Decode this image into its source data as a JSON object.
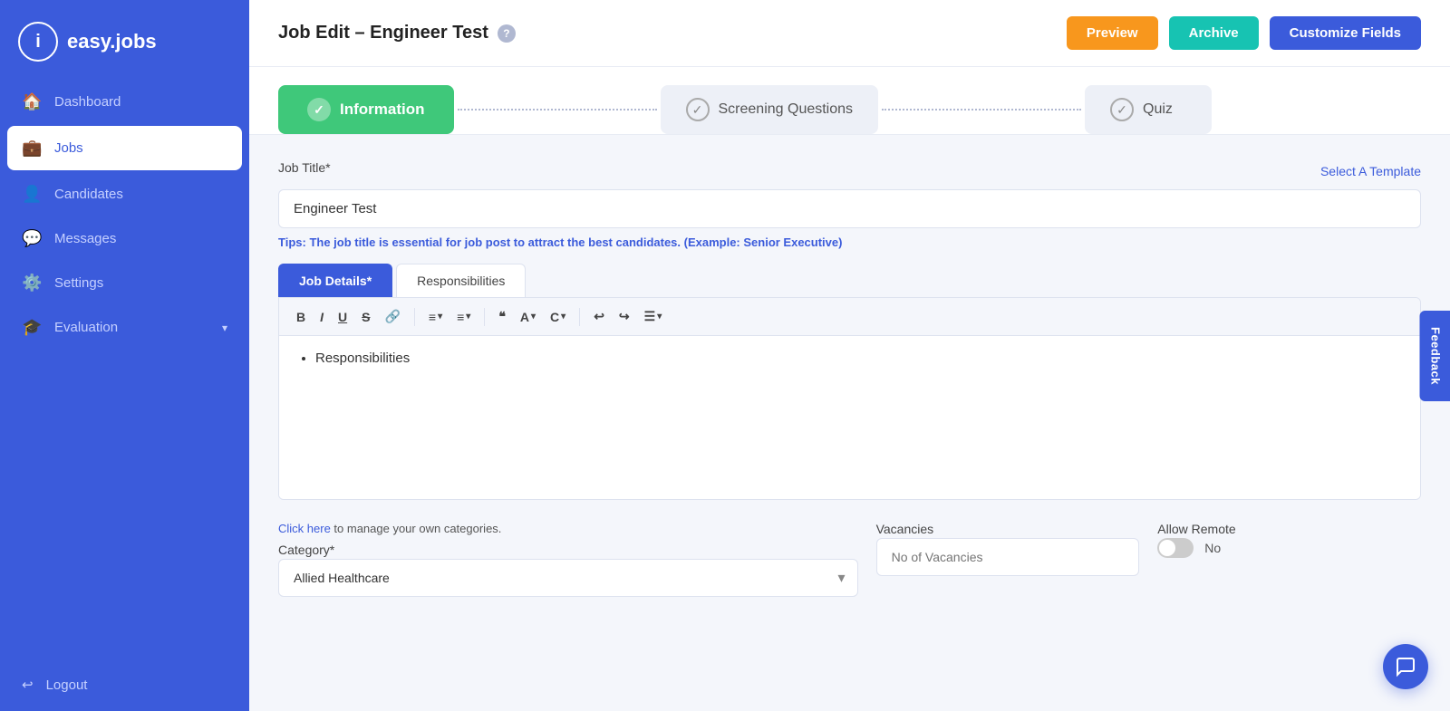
{
  "brand": {
    "logo_text": "i",
    "app_name": "easy.jobs"
  },
  "sidebar": {
    "items": [
      {
        "id": "dashboard",
        "label": "Dashboard",
        "icon": "🏠"
      },
      {
        "id": "jobs",
        "label": "Jobs",
        "icon": "💼",
        "active": true
      },
      {
        "id": "candidates",
        "label": "Candidates",
        "icon": "👤"
      },
      {
        "id": "messages",
        "label": "Messages",
        "icon": "💬"
      },
      {
        "id": "settings",
        "label": "Settings",
        "icon": "⚙️"
      },
      {
        "id": "evaluation",
        "label": "Evaluation",
        "icon": "🎓",
        "has_arrow": true
      }
    ],
    "logout_label": "Logout",
    "logout_icon": "🚪"
  },
  "topbar": {
    "title": "Job Edit – Engineer Test",
    "help_icon": "?",
    "preview_label": "Preview",
    "archive_label": "Archive",
    "customize_label": "Customize Fields"
  },
  "steps": [
    {
      "id": "information",
      "label": "Information",
      "active": true,
      "check": "✓"
    },
    {
      "id": "screening",
      "label": "Screening Questions",
      "active": false,
      "check": "✓"
    },
    {
      "id": "quiz",
      "label": "Quiz",
      "active": false,
      "check": "✓"
    }
  ],
  "form": {
    "job_title_label": "Job Title*",
    "select_template_label": "Select A Template",
    "job_title_value": "Engineer Test",
    "tips_prefix": "Tips:",
    "tips_text": " The job title is essential for job post to attract the best candidates. (Example: Senior Executive)",
    "tab_details": "Job Details*",
    "tab_responsibilities": "Responsibilities",
    "editor_content": "Responsibilities",
    "category_label": "Category*",
    "category_link_text": "Click here",
    "category_link_suffix": " to manage your own categories.",
    "category_value": "Allied Healthcare",
    "vacancies_label": "Vacancies",
    "vacancies_placeholder": "No of Vacancies",
    "allow_remote_label": "Allow Remote",
    "allow_remote_value": "No",
    "toggle_state": false
  },
  "toolbar": {
    "buttons": [
      "B",
      "I",
      "U",
      "S",
      "🔗",
      "≡▾",
      "≡▾",
      "❝",
      "A▾",
      "C▾",
      "↩",
      "↪",
      "≡▾"
    ],
    "bold": "B",
    "italic": "I",
    "underline": "U",
    "strikethrough": "S",
    "link": "🔗",
    "ul": "≡",
    "ol": "≡",
    "quote": "❝",
    "font_color": "A",
    "bg_color": "C",
    "undo": "↩",
    "redo": "↪",
    "align": "≡"
  },
  "feedback": {
    "label": "Feedback"
  }
}
